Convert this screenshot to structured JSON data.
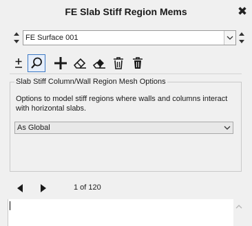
{
  "window": {
    "title": "FE Slab Stiff Region Mems",
    "close_glyph": "✖"
  },
  "entity": {
    "selected": "FE Surface 001"
  },
  "toolbar": {
    "tools": [
      {
        "name": "plus-minus-icon",
        "active": false
      },
      {
        "name": "search-icon",
        "active": true
      },
      {
        "name": "add-icon",
        "active": false
      },
      {
        "name": "eraser-outline-icon",
        "active": false
      },
      {
        "name": "eraser-filled-icon",
        "active": false
      },
      {
        "name": "trash-outline-icon",
        "active": false
      },
      {
        "name": "trash-filled-icon",
        "active": false
      }
    ]
  },
  "group": {
    "legend": "Slab Stiff Column/Wall Region Mesh Options",
    "description": "Options to model stiff regions where walls and columns interact with horizontal slabs.",
    "mesh_option": "As Global"
  },
  "pager": {
    "count_text": "1 of 120"
  },
  "colors": {
    "accent": "#3b78c4",
    "background": "#f0f0f0"
  }
}
